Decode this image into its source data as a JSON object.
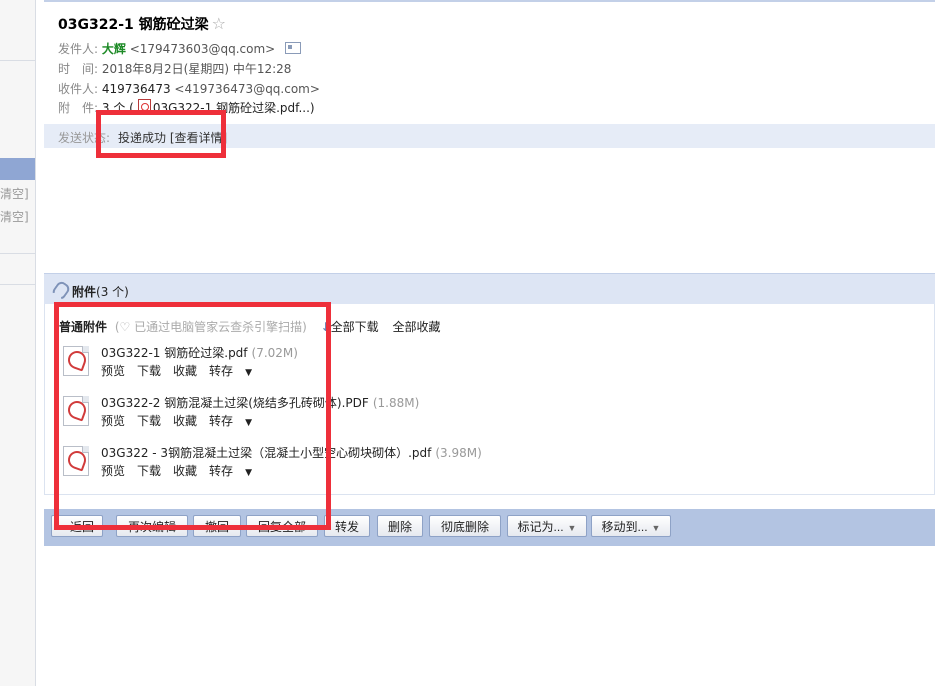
{
  "sidebar": {
    "clear1": "清空]",
    "clear2": "清空]"
  },
  "email": {
    "subject": "03G322-1 钢筋砼过梁",
    "star_icon": "star-outline-icon",
    "from_label": "发件人:",
    "from_name": "大辉",
    "from_addr": "<179473603@qq.com>",
    "time_label": "时　间:",
    "time_value": "2018年8月2日(星期四) 中午12:28",
    "to_label": "收件人:",
    "to_name": "419736473",
    "to_addr": "<419736473@qq.com>",
    "att_label": "附　件:",
    "att_summary_prefix": "3 个 (",
    "att_summary_file": "03G322-1 钢筋砼过梁.pdf...)",
    "status_label": "发送状态:",
    "status_value": "投递成功 [查看详情]"
  },
  "attachments": {
    "header_title": "附件",
    "header_count": "(3 个)",
    "normal_label": "普通附件",
    "scan_text": "(♡ 已通过电脑管家云查杀引擎扫描)",
    "download_all": "全部下载",
    "save_all": "全部收藏",
    "files": [
      {
        "name": "03G322-1 钢筋砼过梁.pdf",
        "size": "(7.02M)",
        "preview": "预览",
        "download": "下载",
        "favorite": "收藏",
        "save_to": "转存"
      },
      {
        "name": "03G322-2 钢筋混凝土过梁(烧结多孔砖砌体).PDF",
        "size": "(1.88M)",
        "preview": "预览",
        "download": "下载",
        "favorite": "收藏",
        "save_to": "转存"
      },
      {
        "name": "03G322 - 3钢筋混凝土过梁（混凝土小型空心砌块砌体）.pdf",
        "size": "(3.98M)",
        "preview": "预览",
        "download": "下载",
        "favorite": "收藏",
        "save_to": "转存"
      }
    ]
  },
  "actions": {
    "back": "« 返回",
    "re_edit": "再次编辑",
    "recall": "撤回",
    "reply_all": "回复全部",
    "forward": "转发",
    "delete": "删除",
    "delete_forever": "彻底删除",
    "mark_as": "标记为...",
    "move_to": "移动到..."
  },
  "colors": {
    "annotation_red": "#ee2f3a",
    "header_bg": "#dde5f4",
    "action_bar_bg": "#b3c4e2",
    "sender_green": "#1d8a26"
  }
}
